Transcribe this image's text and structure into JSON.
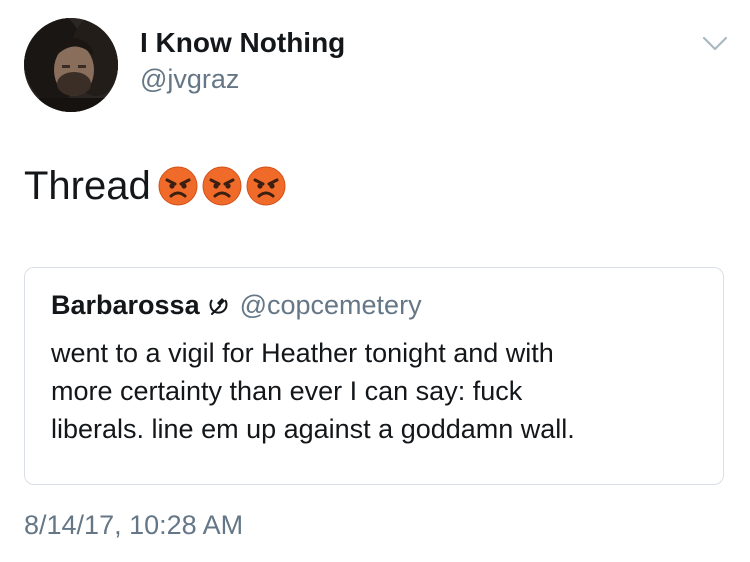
{
  "tweet": {
    "display_name": "I Know Nothing",
    "handle": "@jvgraz",
    "text": "Thread",
    "emojis": [
      "angry-face-icon",
      "angry-face-icon",
      "angry-face-icon"
    ],
    "timestamp": "8/14/17, 10:28 AM"
  },
  "quoted_tweet": {
    "display_name": "Barbarossa",
    "name_icon": "hammer-and-sickle-icon",
    "handle": "@copcemetery",
    "lines": [
      "went to a vigil for Heather tonight and with",
      "more certainty than ever I can say: fuck",
      "liberals. line em up against a goddamn wall."
    ]
  },
  "colors": {
    "text_primary": "#14171a",
    "text_secondary": "#657786",
    "card_border": "#d9dfe4",
    "emoji_face": "#f06a2a",
    "chevron": "#aab8c2"
  }
}
